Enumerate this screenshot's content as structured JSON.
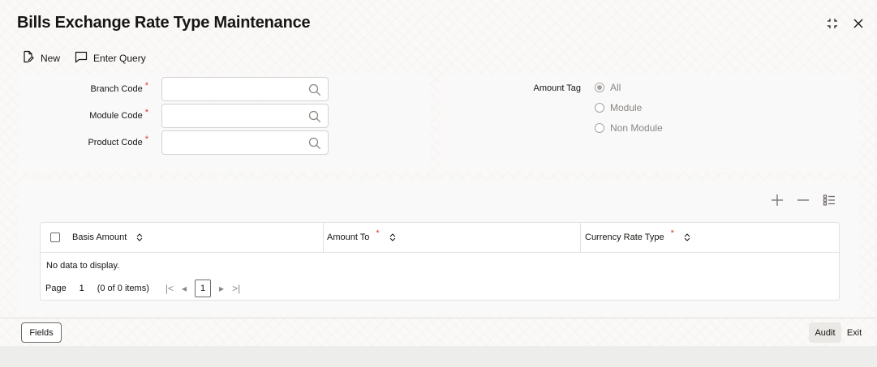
{
  "window": {
    "title": "Bills Exchange Rate Type Maintenance"
  },
  "toolbar": {
    "new_label": "New",
    "enter_query_label": "Enter Query"
  },
  "form": {
    "branch_code_label": "Branch Code",
    "branch_code_value": "",
    "module_code_label": "Module Code",
    "module_code_value": "",
    "product_code_label": "Product Code",
    "product_code_value": "",
    "required_mark": "*"
  },
  "amount_tag": {
    "label": "Amount Tag",
    "options": [
      {
        "label": "All",
        "selected": true
      },
      {
        "label": "Module",
        "selected": false
      },
      {
        "label": "Non Module",
        "selected": false
      }
    ]
  },
  "grid": {
    "columns": [
      {
        "label": "Basis Amount",
        "required": false
      },
      {
        "label": "Amount To",
        "required": true
      },
      {
        "label": "Currency Rate Type",
        "required": true
      }
    ],
    "empty_text": "No data to display.",
    "pager": {
      "page_label": "Page",
      "page_value": "1",
      "items_text": "(0 of 0 items)",
      "current_page": "1"
    }
  },
  "footer": {
    "fields_label": "Fields",
    "audit_label": "Audit",
    "exit_label": "Exit"
  },
  "colors": {
    "required": "#d63b25",
    "text": "#161513",
    "muted": "#8a8783"
  }
}
